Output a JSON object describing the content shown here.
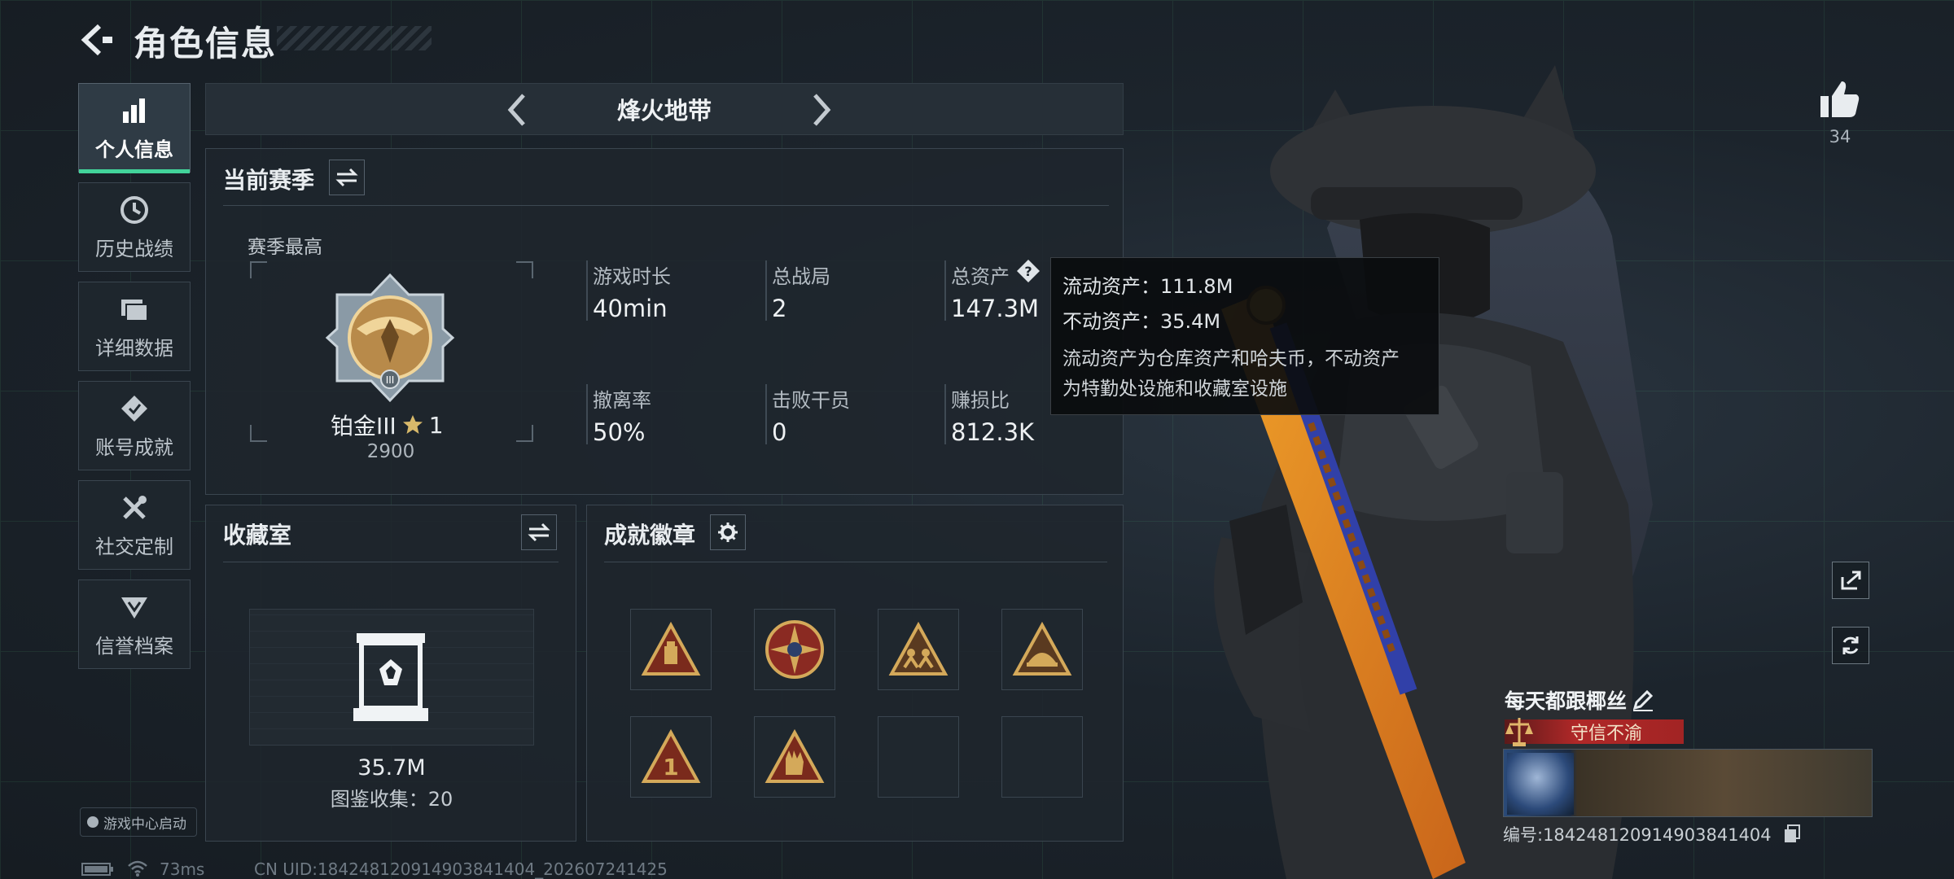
{
  "header": {
    "title": "角色信息"
  },
  "nav": [
    {
      "label": "个人信息",
      "icon": "bar-chart-icon",
      "active": true
    },
    {
      "label": "历史战绩",
      "icon": "history-icon",
      "active": false
    },
    {
      "label": "详细数据",
      "icon": "folder-icon",
      "active": false
    },
    {
      "label": "账号成就",
      "icon": "achievement-icon",
      "active": false
    },
    {
      "label": "社交定制",
      "icon": "tools-icon",
      "active": false
    },
    {
      "label": "信誉档案",
      "icon": "credit-icon",
      "active": false
    }
  ],
  "game_center": "游戏中心启动",
  "mode": {
    "label": "烽火地带"
  },
  "season": {
    "title": "当前赛季",
    "best_label": "赛季最高",
    "rank_name": "铂金III",
    "rank_stars": "1",
    "rank_score": "2900",
    "stats": [
      {
        "label": "游戏时长",
        "value": "40min"
      },
      {
        "label": "总战局",
        "value": "2"
      },
      {
        "label": "总资产",
        "value": "147.3M"
      },
      {
        "label": "撤离率",
        "value": "50%"
      },
      {
        "label": "击败干员",
        "value": "0"
      },
      {
        "label": "赚损比",
        "value": "812.3K"
      }
    ]
  },
  "tooltip": {
    "liquid": "流动资产：111.8M",
    "fixed": "不动资产：35.4M",
    "desc_1": "流动资产为仓库资产和哈夫币，不动资产",
    "desc_2": "为特勤处设施和收藏室设施"
  },
  "collection": {
    "title": "收藏室",
    "value": "35.7M",
    "count": "图鉴收集：20"
  },
  "badges": {
    "title": "成就徽章"
  },
  "profile": {
    "likes": "34",
    "name": "每天都跟椰丝",
    "title_badge": "守信不渝",
    "uid": "编号:18424812091490384140​4"
  },
  "footer": {
    "ping": "73ms",
    "uid": "CN UID:18424812091490384140​4_202607241425"
  },
  "colors": {
    "accent": "#42d39a",
    "gold": "#c9a45c",
    "title_red": "#b02828"
  }
}
